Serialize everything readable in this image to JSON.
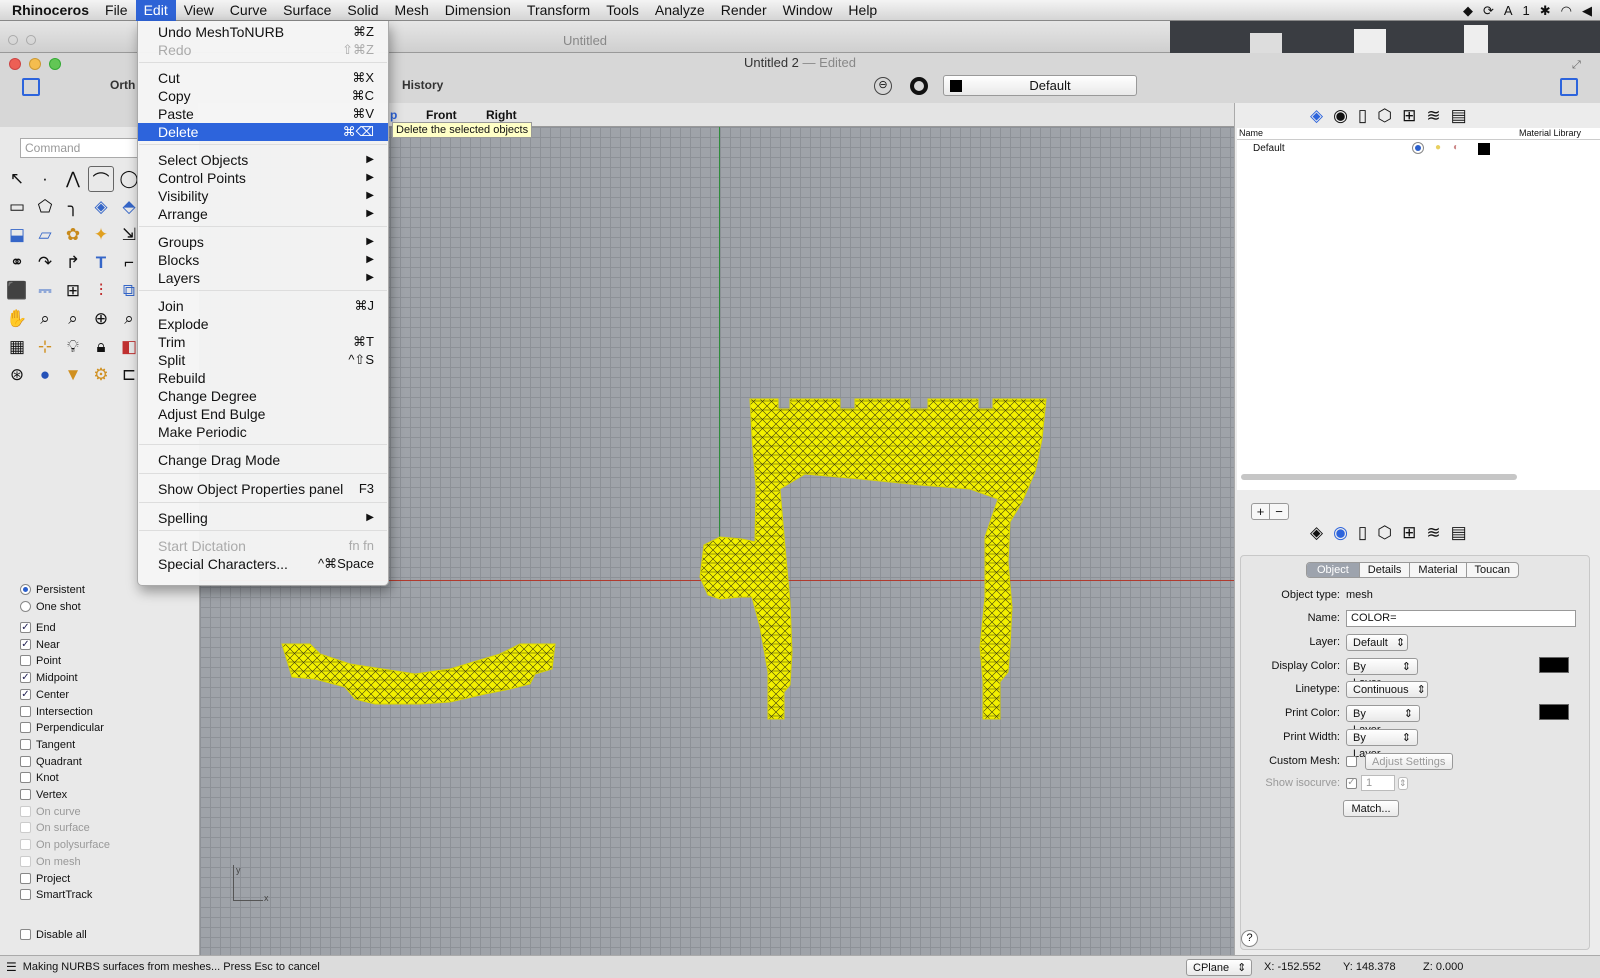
{
  "menubar": {
    "app": "Rhinoceros",
    "items": [
      "File",
      "Edit",
      "View",
      "Curve",
      "Surface",
      "Solid",
      "Mesh",
      "Dimension",
      "Transform",
      "Tools",
      "Analyze",
      "Render",
      "Window",
      "Help"
    ],
    "active": "Edit",
    "status_text": "1"
  },
  "background_window": {
    "title": "Untitled"
  },
  "window": {
    "title": "Untitled 2",
    "subtitle": "— Edited"
  },
  "toolbar": {
    "ortho_label": "Orth",
    "history_label": "History",
    "layer_value": "Default"
  },
  "viewport_tabs": {
    "items": [
      "Front",
      "Right"
    ],
    "partial": "p"
  },
  "command": {
    "placeholder": "Command"
  },
  "edit_menu": {
    "items": [
      {
        "label": "Undo MeshToNURB",
        "shortcut": "⌘Z"
      },
      {
        "label": "Redo",
        "shortcut": "⇧⌘Z",
        "disabled": true
      },
      {
        "label": "Cut",
        "shortcut": "⌘X"
      },
      {
        "label": "Copy",
        "shortcut": "⌘C"
      },
      {
        "label": "Paste",
        "shortcut": "⌘V"
      },
      {
        "label": "Delete",
        "shortcut": "⌘⌫",
        "selected": true
      },
      {
        "label": "Select Objects",
        "submenu": true
      },
      {
        "label": "Control Points",
        "submenu": true
      },
      {
        "label": "Visibility",
        "submenu": true
      },
      {
        "label": "Arrange",
        "submenu": true
      },
      {
        "label": "Groups",
        "submenu": true
      },
      {
        "label": "Blocks",
        "submenu": true
      },
      {
        "label": "Layers",
        "submenu": true
      },
      {
        "label": "Join",
        "shortcut": "⌘J"
      },
      {
        "label": "Explode",
        "shortcut": ""
      },
      {
        "label": "Trim",
        "shortcut": "⌘T"
      },
      {
        "label": "Split",
        "shortcut": "^⇧S"
      },
      {
        "label": "Rebuild",
        "shortcut": ""
      },
      {
        "label": "Change Degree",
        "shortcut": ""
      },
      {
        "label": "Adjust End Bulge",
        "shortcut": ""
      },
      {
        "label": "Make Periodic",
        "shortcut": ""
      },
      {
        "label": "Change Drag Mode",
        "shortcut": ""
      },
      {
        "label": "Show Object Properties panel",
        "shortcut": "F3"
      },
      {
        "label": "Spelling",
        "submenu": true
      },
      {
        "label": "Start Dictation",
        "shortcut": "fn fn",
        "disabled": true
      },
      {
        "label": "Special Characters...",
        "shortcut": "^⌘Space"
      }
    ],
    "tooltip": "Delete the selected objects"
  },
  "osnap": {
    "mode": [
      {
        "label": "Persistent",
        "on": true
      },
      {
        "label": "One shot",
        "on": false
      }
    ],
    "items": [
      {
        "label": "End",
        "on": true,
        "disabled": false
      },
      {
        "label": "Near",
        "on": true,
        "disabled": false
      },
      {
        "label": "Point",
        "on": false,
        "disabled": false
      },
      {
        "label": "Midpoint",
        "on": true,
        "disabled": false
      },
      {
        "label": "Center",
        "on": true,
        "disabled": false
      },
      {
        "label": "Intersection",
        "on": false,
        "disabled": false
      },
      {
        "label": "Perpendicular",
        "on": false,
        "disabled": false
      },
      {
        "label": "Tangent",
        "on": false,
        "disabled": false
      },
      {
        "label": "Quadrant",
        "on": false,
        "disabled": false
      },
      {
        "label": "Knot",
        "on": false,
        "disabled": false
      },
      {
        "label": "Vertex",
        "on": false,
        "disabled": false
      },
      {
        "label": "On curve",
        "on": false,
        "disabled": true
      },
      {
        "label": "On surface",
        "on": false,
        "disabled": true
      },
      {
        "label": "On polysurface",
        "on": false,
        "disabled": true
      },
      {
        "label": "On mesh",
        "on": false,
        "disabled": true
      },
      {
        "label": "Project",
        "on": false,
        "disabled": false
      },
      {
        "label": "SmartTrack",
        "on": false,
        "disabled": false
      }
    ],
    "disable_all": "Disable all"
  },
  "layers_panel": {
    "col_name": "Name",
    "col_material": "Material Library",
    "rows": [
      {
        "name": "Default"
      }
    ],
    "add": "+",
    "remove": "−"
  },
  "properties": {
    "tabs": [
      "Object",
      "Details",
      "Material",
      "Toucan"
    ],
    "active_tab": "Object",
    "object_type_label": "Object type:",
    "object_type": "mesh",
    "name_label": "Name:",
    "name_value": "COLOR=",
    "layer_label": "Layer:",
    "layer_value": "Default",
    "display_color_label": "Display Color:",
    "display_color_value": "By Layer",
    "linetype_label": "Linetype:",
    "linetype_value": "Continuous",
    "print_color_label": "Print Color:",
    "print_color_value": "By Layer",
    "print_width_label": "Print Width:",
    "print_width_value": "By Layer",
    "custom_mesh_label": "Custom Mesh:",
    "adjust_settings": "Adjust Settings",
    "show_isocurve_label": "Show isocurve:",
    "isocurve_value": "1",
    "match": "Match...",
    "help": "?"
  },
  "statusbar": {
    "message": "Making NURBS surfaces from meshes... Press Esc to cancel",
    "cplane": "CPlane",
    "x": "X: -152.552",
    "y": "Y: 148.378",
    "z": "Z: 0.000"
  },
  "axis": {
    "y": "y",
    "x": "x"
  },
  "colors": {
    "mesh": "#f3f000",
    "accent": "#2d64dc",
    "x_axis": "#b03a2e",
    "y_axis": "#2e8b3a"
  }
}
